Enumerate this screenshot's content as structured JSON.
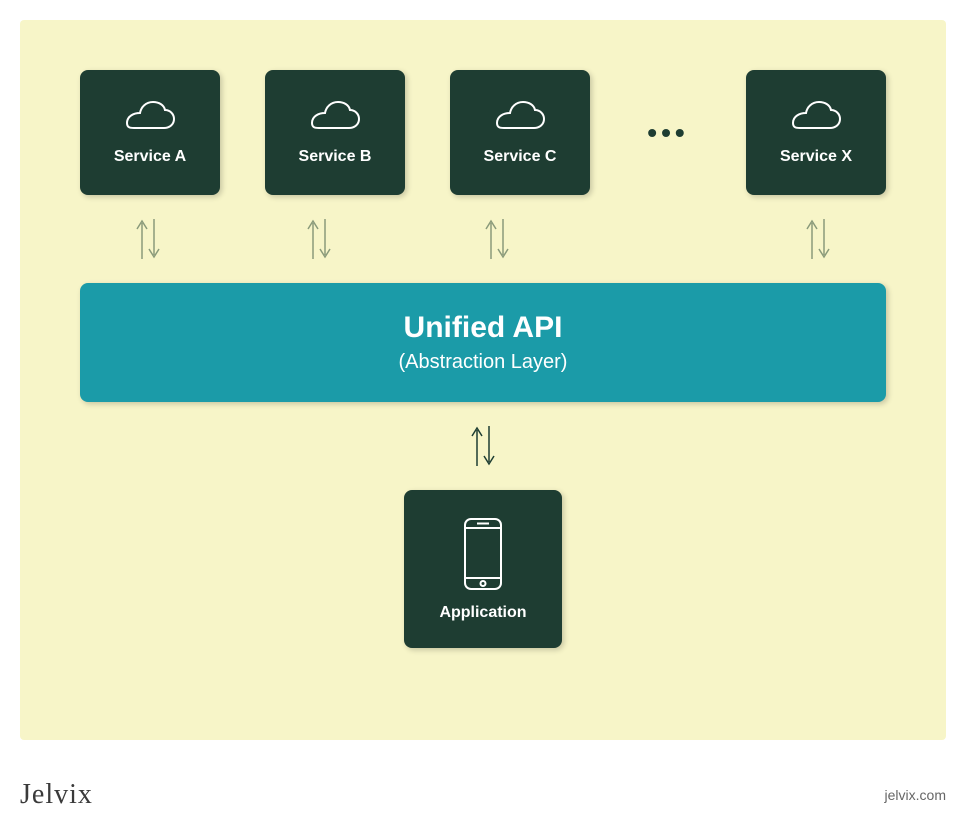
{
  "services": {
    "a": "Service A",
    "b": "Service B",
    "c": "Service C",
    "x": "Service X",
    "ellipsis": "•••"
  },
  "api": {
    "title": "Unified API",
    "subtitle": "(Abstraction Layer)"
  },
  "application": {
    "label": "Application"
  },
  "footer": {
    "logo": "Jelvix",
    "website": "jelvix.com"
  }
}
